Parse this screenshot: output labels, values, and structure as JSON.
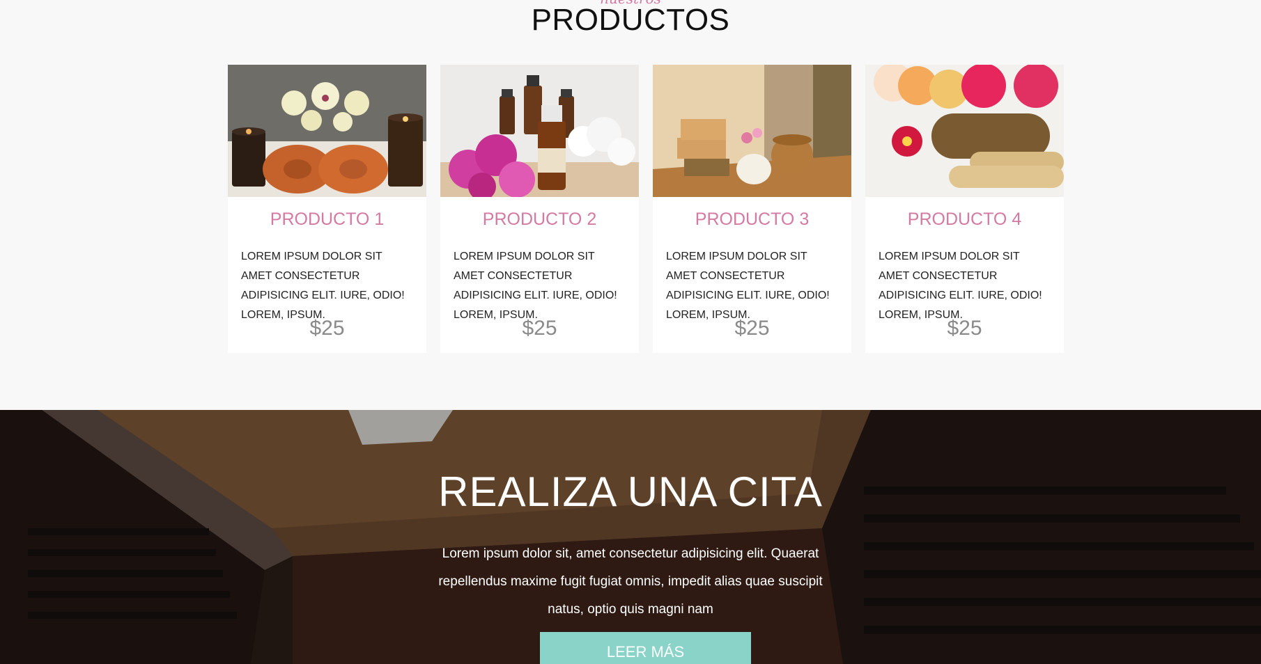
{
  "products_section": {
    "eyebrow": "nuestros",
    "title": "PRODUCTOS",
    "items": [
      {
        "name": "PRODUCTO 1",
        "description": "LOREM IPSUM DOLOR SIT AMET CONSECTETUR ADIPISICING ELIT. IURE, ODIO! LOREM, IPSUM.",
        "price": "$25"
      },
      {
        "name": "PRODUCTO 2",
        "description": "LOREM IPSUM DOLOR SIT AMET CONSECTETUR ADIPISICING ELIT. IURE, ODIO! LOREM, IPSUM.",
        "price": "$25"
      },
      {
        "name": "PRODUCTO 3",
        "description": "LOREM IPSUM DOLOR SIT AMET CONSECTETUR ADIPISICING ELIT. IURE, ODIO! LOREM, IPSUM.",
        "price": "$25"
      },
      {
        "name": "PRODUCTO 4",
        "description": "LOREM IPSUM DOLOR SIT AMET CONSECTETUR ADIPISICING ELIT. IURE, ODIO! LOREM, IPSUM.",
        "price": "$25"
      }
    ]
  },
  "appointment": {
    "title": "REALIZA UNA CITA",
    "text": "Lorem ipsum dolor sit, amet consectetur adipisicing elit. Quaerat repellendus maxime fugit fugiat omnis, impedit alias quae suscipit natus, optio quis magni nam",
    "button_label": "LEER MÁS"
  },
  "colors": {
    "accent_pink": "#d47aa2",
    "button_teal": "#89d3c8",
    "section_bg": "#f8f8f8"
  }
}
